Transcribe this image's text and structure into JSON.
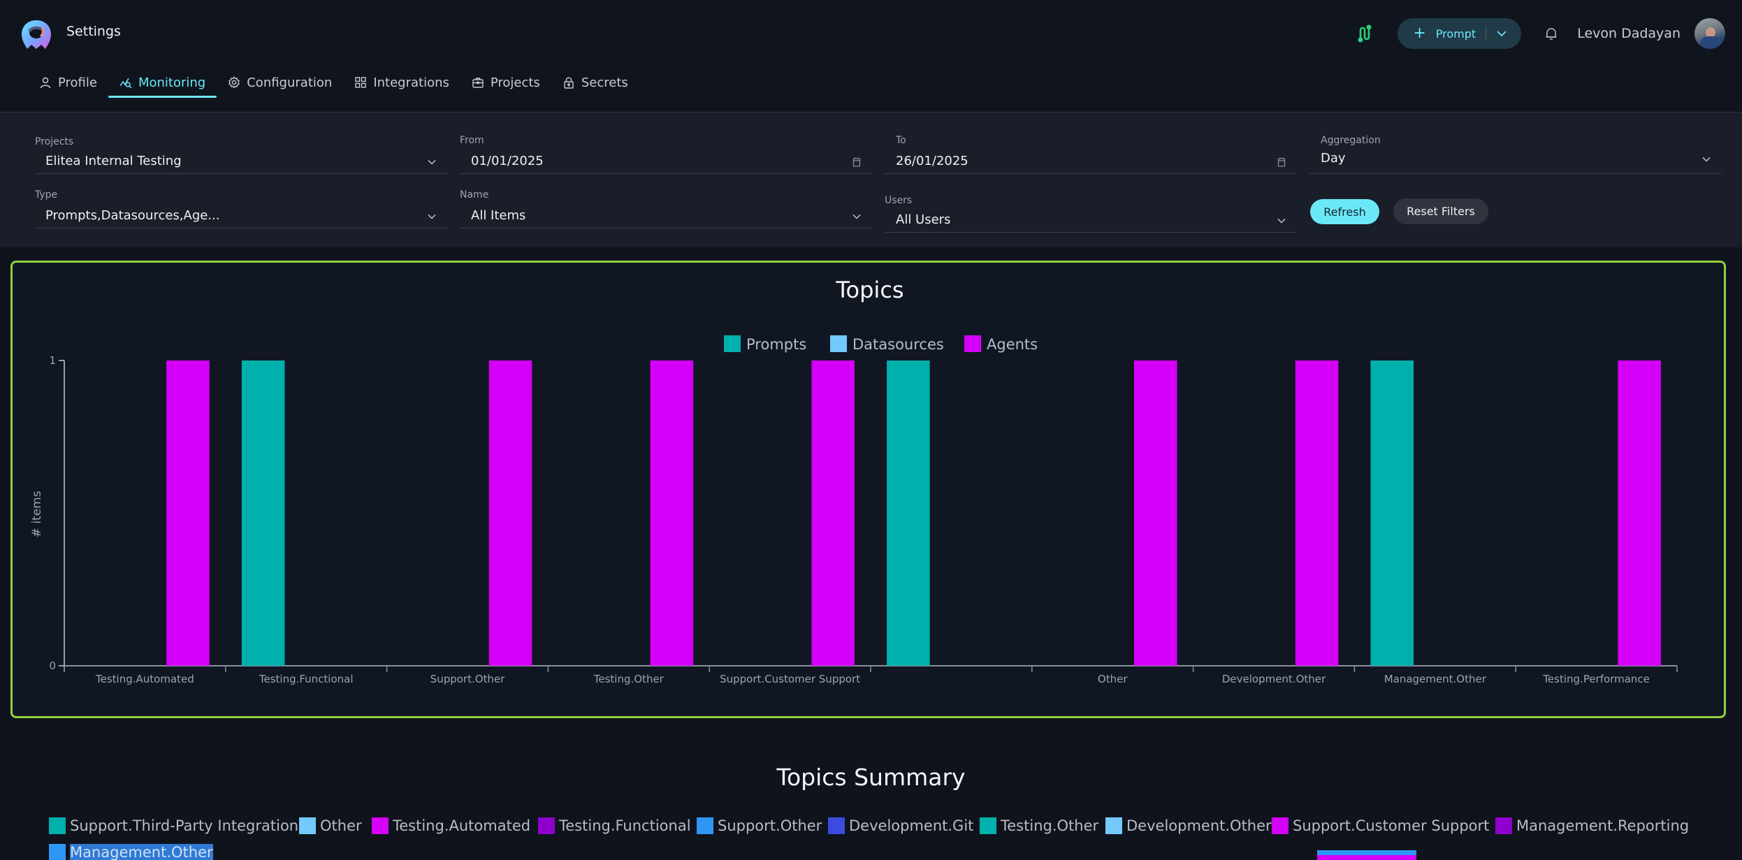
{
  "header": {
    "app_title": "Settings",
    "tabs": [
      {
        "label": "Profile",
        "icon": "user-icon",
        "active": false
      },
      {
        "label": "Monitoring",
        "icon": "monitoring-icon",
        "active": true
      },
      {
        "label": "Configuration",
        "icon": "gear-icon",
        "active": false
      },
      {
        "label": "Integrations",
        "icon": "grid-icon",
        "active": false
      },
      {
        "label": "Projects",
        "icon": "briefcase-icon",
        "active": false
      },
      {
        "label": "Secrets",
        "icon": "lock-icon",
        "active": false
      }
    ],
    "prompt_button": {
      "label": "Prompt",
      "icon": "plus-icon"
    },
    "user_name": "Levon Dadayan"
  },
  "filters": {
    "projects": {
      "label": "Projects",
      "value": "Elitea Internal Testing"
    },
    "from": {
      "label": "From",
      "value": "01/01/2025"
    },
    "to": {
      "label": "To",
      "value": "26/01/2025"
    },
    "aggregation": {
      "label": "Aggregation",
      "value": "Day"
    },
    "type": {
      "label": "Type",
      "value": "Prompts,Datasources,Age..."
    },
    "name": {
      "label": "Name",
      "value": "All Items"
    },
    "users": {
      "label": "Users",
      "value": "All Users"
    },
    "refresh_label": "Refresh",
    "reset_label": "Reset Filters"
  },
  "colors": {
    "accent": "#6ae8f8",
    "card_border": "#8fd13c",
    "prompts": "#00b0ad",
    "datasources": "#74c9fd",
    "agents": "#d500f9"
  },
  "chart_data": {
    "type": "bar",
    "title": "Topics",
    "xlabel": "",
    "ylabel": "# items",
    "ylim": [
      0,
      1
    ],
    "yticks": [
      0,
      1
    ],
    "legend_position": "top-center",
    "categories": [
      "Testing.Automated",
      "Testing.Functional",
      "Support.Other",
      "Testing.Other",
      "Support.Customer Support",
      "",
      "Other",
      "Development.Other",
      "Management.Other",
      "Testing.Performance"
    ],
    "series": [
      {
        "name": "Prompts",
        "color": "#00b0ad",
        "values": [
          0,
          1,
          0,
          0,
          0,
          1,
          0,
          0,
          1,
          0
        ]
      },
      {
        "name": "Datasources",
        "color": "#74c9fd",
        "values": [
          0,
          0,
          0,
          0,
          0,
          0,
          0,
          0,
          0,
          0
        ]
      },
      {
        "name": "Agents",
        "color": "#d500f9",
        "values": [
          1,
          0,
          1,
          1,
          1,
          0,
          1,
          1,
          0,
          1
        ]
      }
    ]
  },
  "summary": {
    "title": "Topics Summary",
    "legend": [
      {
        "label": "Support.Third-Party Integration",
        "color": "#00b0ad"
      },
      {
        "label": "Other",
        "color": "#74c9fd"
      },
      {
        "label": "Testing.Automated",
        "color": "#d500f9"
      },
      {
        "label": "Testing.Functional",
        "color": "#9000cc"
      },
      {
        "label": "Support.Other",
        "color": "#2f96f4"
      },
      {
        "label": "Development.Git",
        "color": "#3d4ae0"
      },
      {
        "label": "Testing.Other",
        "color": "#00b0ad"
      },
      {
        "label": "Development.Other",
        "color": "#74c9fd"
      },
      {
        "label": "Support.Customer Support",
        "color": "#d500f9"
      },
      {
        "label": "Management.Reporting",
        "color": "#9000cc"
      },
      {
        "label": "Management.Other",
        "color": "#2f96f4"
      }
    ]
  }
}
